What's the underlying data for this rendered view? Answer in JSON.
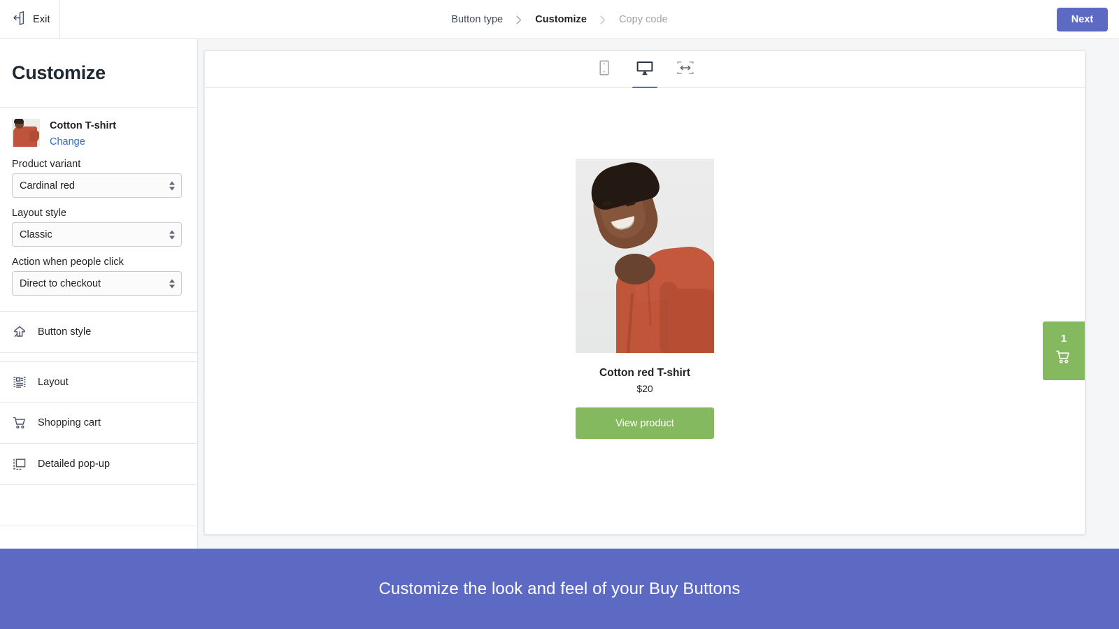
{
  "topbar": {
    "exit_label": "Exit",
    "exit_icon": "exit-door-arrow-icon",
    "next_label": "Next",
    "breadcrumbs": [
      {
        "label": "Button type",
        "state": "done"
      },
      {
        "label": "Customize",
        "state": "active"
      },
      {
        "label": "Copy code",
        "state": "upcoming"
      }
    ]
  },
  "sidebar": {
    "title": "Customize",
    "product": {
      "name": "Cotton T-shirt",
      "change_label": "Change",
      "thumbnail_alt": "cotton-tshirt-thumbnail"
    },
    "fields": [
      {
        "label": "Product variant",
        "value": "Cardinal red",
        "name": "product-variant"
      },
      {
        "label": "Layout style",
        "value": "Classic",
        "name": "layout-style"
      },
      {
        "label": "Action when people click",
        "value": "Direct to checkout",
        "name": "click-action"
      }
    ],
    "nav_items": [
      {
        "label": "Button style",
        "icon": "button-style-icon"
      },
      {
        "label": "Layout",
        "icon": "layout-icon"
      },
      {
        "label": "Shopping cart",
        "icon": "shopping-cart-icon"
      },
      {
        "label": "Detailed pop-up",
        "icon": "popup-icon"
      }
    ]
  },
  "preview": {
    "device_tabs": [
      {
        "name": "mobile",
        "icon": "mobile-icon",
        "active": false
      },
      {
        "name": "desktop",
        "icon": "desktop-monitor-icon",
        "active": true
      },
      {
        "name": "full-width",
        "icon": "full-width-icon",
        "active": false
      }
    ],
    "product": {
      "title": "Cotton red T-shirt",
      "price": "$20",
      "button_label": "View product",
      "image_alt": "woman-wearing-red-tshirt"
    },
    "cart": {
      "count": "1",
      "icon": "shopping-cart-icon"
    }
  },
  "banner": {
    "text": "Customize the look and feel of your Buy Buttons"
  },
  "colors": {
    "accent_purple": "#5c6ac4",
    "button_green": "#85b95f",
    "link_blue": "#2c6ecb",
    "text_dark": "#202223"
  }
}
